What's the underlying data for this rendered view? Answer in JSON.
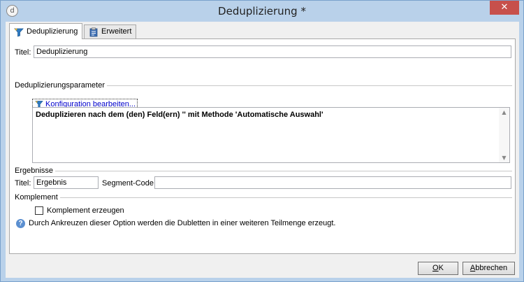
{
  "window": {
    "title": "Deduplizierung *",
    "app_icon_glyph": "d",
    "close_glyph": "✕"
  },
  "tabs": [
    {
      "label": "Deduplizierung",
      "icon": "funnel-icon",
      "active": true
    },
    {
      "label": "Erweitert",
      "icon": "clipboard-icon",
      "active": false
    }
  ],
  "main": {
    "title_label": "Titel:",
    "title_value": "Deduplizierung",
    "params_section": "Deduplizierungsparameter",
    "config_link": "Konfiguration bearbeiten...",
    "description": "Deduplizieren nach dem (den) Feld(ern) '' mit Methode 'Automatische Auswahl'",
    "results_section": "Ergebnisse",
    "result_title_label": "Titel:",
    "result_title_value": "Ergebnis",
    "segment_code_label": "Segment-Code:",
    "segment_code_value": "",
    "complement_section": "Komplement",
    "complement_checkbox_label": "Komplement erzeugen",
    "complement_checked": false,
    "info_text": "Durch Ankreuzen dieser Option werden die Dubletten in einer weiteren Teilmenge erzeugt."
  },
  "buttons": {
    "ok": {
      "first": "O",
      "rest": "K"
    },
    "cancel": {
      "first": "A",
      "rest": "bbrechen"
    }
  },
  "colors": {
    "titlebar": "#b9d1ea",
    "close": "#c7504b",
    "link": "#0000cc",
    "info": "#5b8fd0",
    "funnel": "#2e7bc4"
  }
}
